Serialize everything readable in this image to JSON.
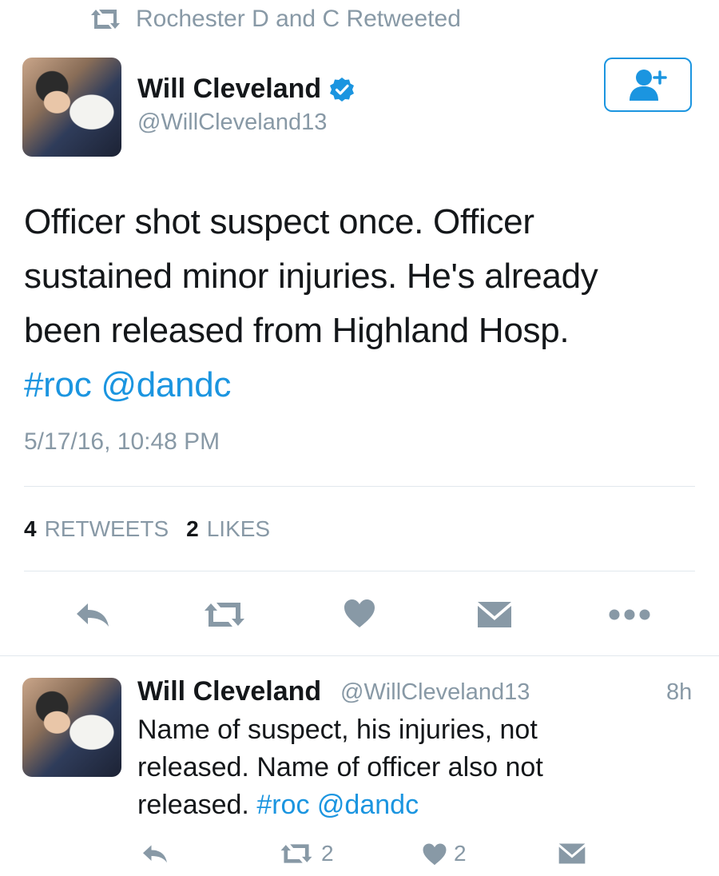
{
  "retweet_context": {
    "icon": "retweet-icon",
    "text": "Rochester D and C Retweeted"
  },
  "tweet": {
    "author": {
      "name": "Will Cleveland",
      "handle": "@WillCleveland13",
      "verified": true
    },
    "follow_button": {
      "icon": "add-user-icon"
    },
    "text_line1": "Officer shot suspect once. Officer",
    "text_line2": "sustained minor injuries. He's already",
    "text_line3": "been released from Highland Hosp.",
    "hashtag": "#roc",
    "mention": "@dandc",
    "timestamp": "5/17/16, 10:48 PM",
    "stats": {
      "retweets_count": "4",
      "retweets_label": "RETWEETS",
      "likes_count": "2",
      "likes_label": "LIKES"
    },
    "actions": [
      "reply-icon",
      "retweet-icon",
      "heart-icon",
      "message-icon",
      "more-icon"
    ]
  },
  "reply": {
    "author": {
      "name": "Will Cleveland",
      "handle": "@WillCleveland13"
    },
    "time": "8h",
    "text_line1": "Name of suspect, his injuries, not",
    "text_line2": "released. Name of officer also not",
    "text_line3_prefix": "released.",
    "hashtag": "#roc",
    "mention": "@dandc",
    "actions": {
      "retweet_count": "2",
      "like_count": "2"
    }
  },
  "colors": {
    "accent": "#1b95e0",
    "muted": "#8899a6",
    "text": "#14171a",
    "divider": "#e1e8ed"
  }
}
